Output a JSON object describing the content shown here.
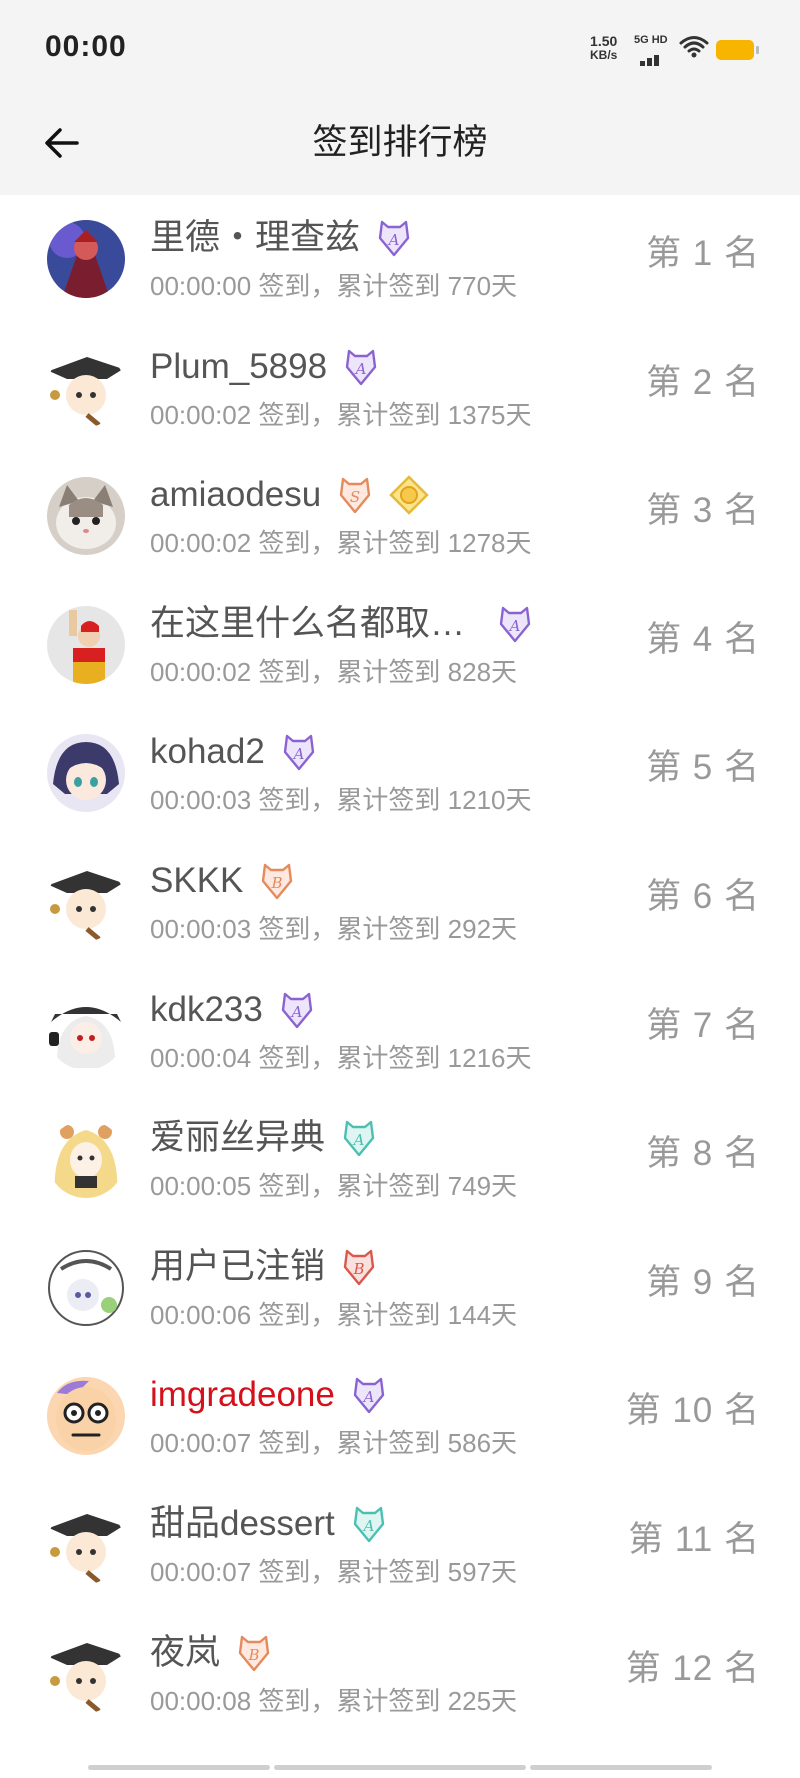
{
  "status_bar": {
    "time": "00:00",
    "net_speed_value": "1.50",
    "net_speed_unit": "KB/s",
    "network": "5G HD",
    "battery_color": "#f7b500"
  },
  "header": {
    "title": "签到排行榜",
    "back_icon": "arrow-left-icon"
  },
  "accent_red": "#d4111b",
  "rows": [
    {
      "name": "里德・理查兹",
      "sub": "00:00:00 签到，累计签到 770天",
      "rank": "第 1 名",
      "badges": [
        "purple-a-badge-icon"
      ],
      "avatar": "hero-avatar",
      "highlight": false
    },
    {
      "name": "Plum_5898",
      "sub": "00:00:02 签到，累计签到 1375天",
      "rank": "第 2 名",
      "badges": [
        "purple-a-badge-icon"
      ],
      "avatar": "anime-witch-avatar",
      "highlight": false
    },
    {
      "name": "amiaodesu",
      "sub": "00:00:02 签到，累计签到 1278天",
      "rank": "第 3 名",
      "badges": [
        "orange-s-badge-icon",
        "gold-flower-badge-icon"
      ],
      "avatar": "cat-avatar",
      "highlight": false
    },
    {
      "name": "在这里什么名都取…",
      "sub": "00:00:02 签到，累计签到 828天",
      "rank": "第 4 名",
      "badges": [
        "purple-a-badge-icon"
      ],
      "avatar": "clown-avatar",
      "highlight": false
    },
    {
      "name": "kohad2",
      "sub": "00:00:03 签到，累计签到 1210天",
      "rank": "第 5 名",
      "badges": [
        "purple-a-badge-icon"
      ],
      "avatar": "anime-girl-avatar",
      "highlight": false
    },
    {
      "name": "SKKK",
      "sub": "00:00:03 签到，累计签到 292天",
      "rank": "第 6 名",
      "badges": [
        "orange-b-badge-icon"
      ],
      "avatar": "anime-witch-avatar",
      "highlight": false
    },
    {
      "name": "kdk233",
      "sub": "00:00:04 签到，累计签到 1216天",
      "rank": "第 7 名",
      "badges": [
        "purple-a-badge-icon"
      ],
      "avatar": "anime-white-hair-avatar",
      "highlight": false
    },
    {
      "name": "爱丽丝异典",
      "sub": "00:00:05 签到，累计签到 749天",
      "rank": "第 8 名",
      "badges": [
        "teal-a-badge-icon"
      ],
      "avatar": "anime-blonde-avatar",
      "highlight": false
    },
    {
      "name": "用户已注销",
      "sub": "00:00:06 签到，累计签到 144天",
      "rank": "第 9 名",
      "badges": [
        "red-b-badge-icon"
      ],
      "avatar": "so-good-avatar",
      "highlight": false
    },
    {
      "name": "imgradeone",
      "sub": "00:00:07 签到，累计签到 586天",
      "rank": "第 10 名",
      "badges": [
        "purple-a-badge-icon"
      ],
      "avatar": "cartoon-face-avatar",
      "highlight": true
    },
    {
      "name": "甜品dessert",
      "sub": "00:00:07 签到，累计签到 597天",
      "rank": "第 11 名",
      "badges": [
        "teal-a-badge-icon"
      ],
      "avatar": "anime-witch-avatar",
      "highlight": false
    },
    {
      "name": "夜岚",
      "sub": "00:00:08 签到，累计签到 225天",
      "rank": "第 12 名",
      "badges": [
        "orange-b-badge-icon"
      ],
      "avatar": "anime-witch-avatar",
      "highlight": false
    }
  ]
}
